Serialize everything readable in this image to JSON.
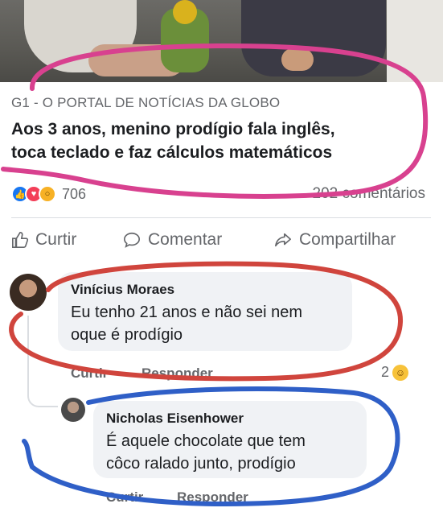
{
  "post": {
    "source": "G1 - O PORTAL DE NOTÍCIAS DA GLOBO",
    "headline_line1": "Aos 3 anos, menino prodígio fala inglês,",
    "headline_line2": "toca teclado e faz cálculos matemáticos",
    "reaction_count": "706",
    "comment_count": "202 comentários"
  },
  "actions": {
    "like": "Curtir",
    "comment": "Comentar",
    "share": "Compartilhar"
  },
  "comments": [
    {
      "author": "Vinícius Moraes",
      "text_line1": "Eu tenho 21 anos e não sei nem",
      "text_line2": "oque é prodígio",
      "like": "Curtir",
      "reply": "Responder",
      "reaction_count": "2",
      "reaction_icon": "laugh-emoji-icon"
    },
    {
      "author": "Nicholas Eisenhower",
      "text_line1": "É aquele chocolate que tem",
      "text_line2": "côco ralado junto, prodígio",
      "like": "Curtir",
      "reply": "Responder"
    }
  ],
  "colors": {
    "circle_pink": "#d8418f",
    "circle_red": "#d0453d",
    "circle_blue": "#2f5fc7",
    "like_blue": "#1877f2",
    "text_gray": "#65676b"
  }
}
